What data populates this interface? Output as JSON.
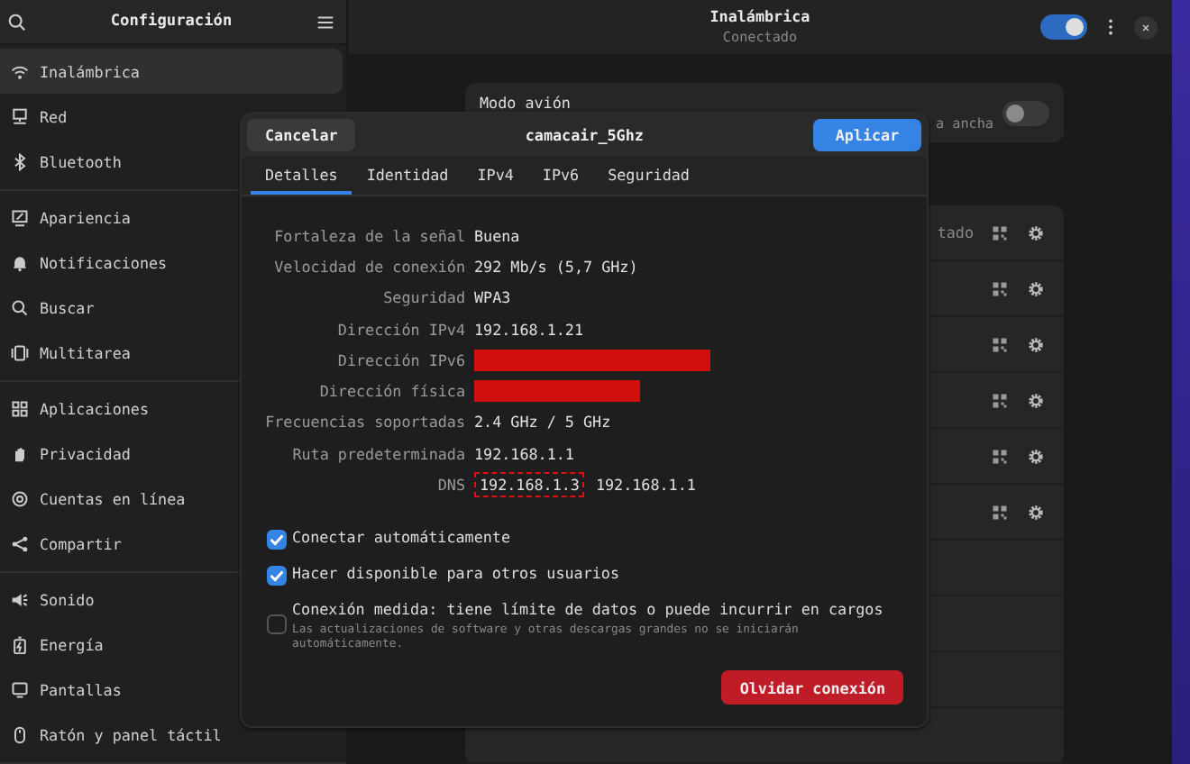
{
  "sidebar": {
    "title": "Configuración",
    "groups": [
      [
        {
          "label": "Inalámbrica",
          "selected": true
        },
        {
          "label": "Red",
          "selected": false
        },
        {
          "label": "Bluetooth",
          "selected": false
        }
      ],
      [
        {
          "label": "Apariencia",
          "selected": false
        },
        {
          "label": "Notificaciones",
          "selected": false
        },
        {
          "label": "Buscar",
          "selected": false
        },
        {
          "label": "Multitarea",
          "selected": false
        }
      ],
      [
        {
          "label": "Aplicaciones",
          "selected": false
        },
        {
          "label": "Privacidad",
          "selected": false
        },
        {
          "label": "Cuentas en línea",
          "selected": false
        },
        {
          "label": "Compartir",
          "selected": false
        }
      ],
      [
        {
          "label": "Sonido",
          "selected": false
        },
        {
          "label": "Energía",
          "selected": false
        },
        {
          "label": "Pantallas",
          "selected": false
        },
        {
          "label": "Ratón y panel táctil",
          "selected": false
        }
      ]
    ]
  },
  "header": {
    "title": "Inalámbrica",
    "subtitle": "Conectado",
    "wifi_on": true
  },
  "airplane": {
    "label": "Modo avión",
    "note": "a ancha",
    "on": false
  },
  "networks": [
    {
      "kind": "saved",
      "status": "tado"
    },
    {
      "kind": "saved"
    },
    {
      "kind": "saved"
    },
    {
      "kind": "saved"
    },
    {
      "kind": "saved"
    },
    {
      "kind": "saved"
    },
    {
      "kind": "plain"
    },
    {
      "kind": "plain"
    },
    {
      "kind": "plain"
    },
    {
      "kind": "plain"
    }
  ],
  "dialog": {
    "cancel": "Cancelar",
    "title": "camacair_5Ghz",
    "apply": "Aplicar",
    "tabs": [
      {
        "label": "Detalles",
        "selected": true
      },
      {
        "label": "Identidad",
        "selected": false
      },
      {
        "label": "IPv4",
        "selected": false
      },
      {
        "label": "IPv6",
        "selected": false
      },
      {
        "label": "Seguridad",
        "selected": false
      }
    ],
    "details": [
      {
        "kind": "text",
        "label": "Fortaleza de la señal",
        "value": "Buena"
      },
      {
        "kind": "text",
        "label": "Velocidad de conexión",
        "value": "292 Mb/s (5,7 GHz)"
      },
      {
        "kind": "text",
        "label": "Seguridad",
        "value": "WPA3"
      },
      {
        "kind": "text",
        "label": "Dirección IPv4",
        "value": "192.168.1.21"
      },
      {
        "kind": "redacted",
        "label": "Dirección IPv6"
      },
      {
        "kind": "redacted",
        "label": "Dirección física"
      },
      {
        "kind": "text",
        "label": "Frecuencias soportadas",
        "value": "2.4 GHz / 5 GHz"
      },
      {
        "kind": "text",
        "label": "Ruta predeterminada",
        "value": "192.168.1.1"
      },
      {
        "kind": "list",
        "label": "DNS",
        "values": [
          {
            "text": "192.168.1.3",
            "outlined": true
          },
          {
            "text": "192.168.1.1",
            "outlined": false
          }
        ]
      }
    ],
    "options": [
      {
        "label": "Conectar automáticamente",
        "checked": true
      },
      {
        "label": "Hacer disponible para otros usuarios",
        "checked": true
      },
      {
        "label": "Conexión medida: tiene límite de datos o puede incurrir en cargos",
        "hint": "Las actualizaciones de software y otras descargas grandes no se iniciarán automáticamente.",
        "checked": false
      }
    ],
    "forget": "Olvidar conexión"
  }
}
